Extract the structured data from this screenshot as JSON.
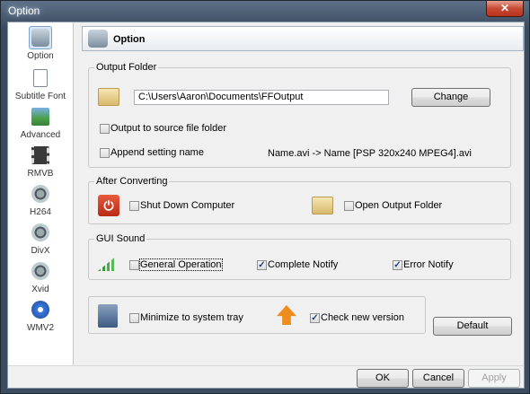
{
  "window": {
    "title": "Option",
    "close_glyph": "✕"
  },
  "sidebar": {
    "items": [
      {
        "label": "Option",
        "icon": "camera-icon",
        "active": true
      },
      {
        "label": "Subtitle Font",
        "icon": "document-icon"
      },
      {
        "label": "Advanced",
        "icon": "picture-icon"
      },
      {
        "label": "RMVB",
        "icon": "film-icon"
      },
      {
        "label": "H264",
        "icon": "film-reel-icon"
      },
      {
        "label": "DivX",
        "icon": "film-reel-icon"
      },
      {
        "label": "Xvid",
        "icon": "film-reel-icon"
      },
      {
        "label": "WMV2",
        "icon": "media-player-icon"
      }
    ]
  },
  "header": {
    "title": "Option",
    "icon": "camera-icon"
  },
  "output_folder": {
    "legend": "Output Folder",
    "path_value": "C:\\Users\\Aaron\\Documents\\FFOutput",
    "change_label": "Change",
    "source_folder": {
      "label": "Output to source file folder",
      "checked": false
    },
    "append_name": {
      "label": "Append setting name",
      "checked": false
    },
    "name_example": "Name.avi  -> Name [PSP 320x240 MPEG4].avi"
  },
  "after_converting": {
    "legend": "After Converting",
    "shutdown": {
      "label": "Shut Down Computer",
      "checked": false
    },
    "open_folder": {
      "label": "Open Output Folder",
      "checked": false
    }
  },
  "gui_sound": {
    "legend": "GUI Sound",
    "general": {
      "label": "General Operation",
      "checked": false
    },
    "complete": {
      "label": "Complete Notify",
      "checked": true
    },
    "error": {
      "label": "Error Notify",
      "checked": true
    }
  },
  "misc": {
    "minimize_tray": {
      "label": "Minimize to system tray",
      "checked": false
    },
    "check_version": {
      "label": "Check new version",
      "checked": true
    },
    "default_label": "Default"
  },
  "footer": {
    "ok_label": "OK",
    "cancel_label": "Cancel",
    "apply_label": "Apply"
  }
}
